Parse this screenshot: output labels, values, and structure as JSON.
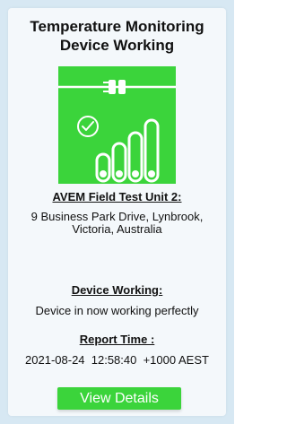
{
  "card": {
    "title": "Temperature Monitoring Device Working",
    "icon": "plug-signal-bars-check-icon",
    "unit_heading": "AVEM Field Test Unit 2:",
    "address": "9 Business Park Drive, Lynbrook, Victoria, Australia",
    "status_heading": "Device Working:",
    "status_text": "Device in now working perfectly",
    "report_heading": "Report Time :",
    "report_time": "2021-08-24  12:58:40  +1000 AEST",
    "button_label": "View Details"
  },
  "colors": {
    "accent": "#3bd43b",
    "background": "#d7e8f3",
    "card": "#f4f8fb"
  }
}
